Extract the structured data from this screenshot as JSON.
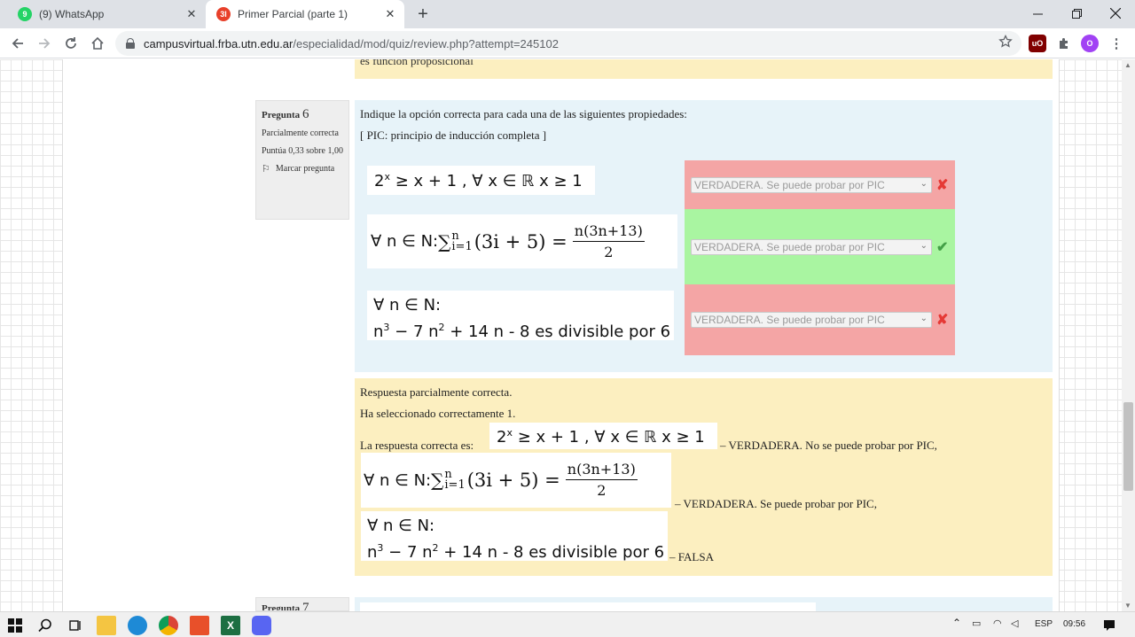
{
  "browser": {
    "tabs": [
      {
        "favicon": "9",
        "title": "(9) WhatsApp"
      },
      {
        "favicon": "3l",
        "title": "Primer Parcial (parte 1)"
      }
    ],
    "close_glyph": "✕",
    "new_tab_glyph": "+",
    "url_host": "campusvirtual.frba.utn.edu.ar",
    "url_path": "/especialidad/mod/quiz/review.php?attempt=245102",
    "profile_initial": "O",
    "ublock_label": "uO"
  },
  "prev_question_feedback_tail": "es función proposicional",
  "question6": {
    "label": "Pregunta",
    "number": "6",
    "state": "Parcialmente correcta",
    "grade": "Puntúa 0,33 sobre 1,00",
    "flag_label": "Marcar pregunta",
    "text_line1": "Indique la opción correcta para cada una de las siguientes propiedades:",
    "text_line2": "[ PIC: principio de inducción completa ]",
    "stems": {
      "s1_base": "2",
      "s1_exp": "x",
      "s1_rest": " ≥  x + 1 , ∀ x ∈ ℝ   x ≥ 1",
      "s2_prefix": "∀ n ∈ N: ",
      "s2_sum": "∑",
      "s2_upper": "n",
      "s2_lower": "i=1",
      "s2_term": "(3i + 5) = ",
      "s2_num": "n(3n+13)",
      "s2_den": "2",
      "s3_line1": "∀ n ∈ N:",
      "s3_line2_n": "n",
      "s3_line2_exp3": "3",
      "s3_line2_mid": " − 7 n",
      "s3_line2_exp2": "2",
      "s3_line2_end": " + 14 n - 8 es divisible por 6"
    },
    "answers": [
      {
        "selected": "VERDADERA. Se puede probar por PIC",
        "result": "incorrect",
        "mark": "✘"
      },
      {
        "selected": "VERDADERA. Se puede probar por PIC",
        "result": "correct",
        "mark": "✔"
      },
      {
        "selected": "VERDADERA. Se puede probar por PIC",
        "result": "incorrect",
        "mark": "✘"
      }
    ],
    "feedback": {
      "line1": "Respuesta parcialmente correcta.",
      "line2": "Ha seleccionado correctamente 1.",
      "line3_prefix": "La respuesta correcta es:",
      "ans1": "– VERDADERA. No se puede probar por PIC,",
      "ans2": "– VERDADERA. Se puede probar por PIC,",
      "ans3": "– FALSA"
    }
  },
  "question7": {
    "label": "Pregunta",
    "number": "7"
  },
  "taskbar": {
    "language": "ESP",
    "time": "09:56"
  }
}
